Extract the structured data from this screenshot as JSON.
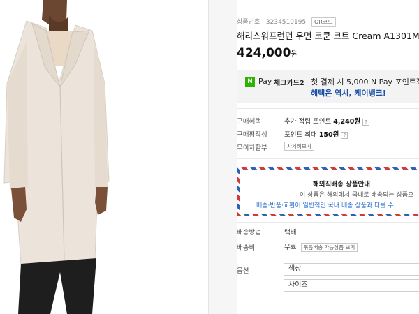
{
  "product": {
    "number_label": "상품번호 :",
    "number": "3234510195",
    "qr_label": "QR코드",
    "title": "해리스워프런던 우먼 코쿤 코트 Cream A1301MLK",
    "price": "424,000",
    "price_unit": "원"
  },
  "promo": {
    "npay_icon": "N",
    "npay_label": "Pay",
    "card_label": "체크카드2",
    "line1": "첫 결제 시 5,000 N Pay 포인트적립",
    "line2": "혜택은 역시, 케이뱅크!"
  },
  "benefits": {
    "purchase_benefit_label": "구매혜택",
    "purchase_benefit_text": "추가 적립 포인트",
    "purchase_benefit_value": "4,240원",
    "review_label": "구매평작성",
    "review_text": "포인트 최대",
    "review_value": "150원",
    "installment_label": "무이자할부",
    "installment_btn": "자세히보기",
    "help_glyph": "?"
  },
  "overseas": {
    "title": "해외직배송 상품안내",
    "line1": "이 상품은 해외에서 국내로 배송되는 상품으",
    "line2": "배송·반품·교환이 일반적인 국내 배송 상품과 다를 수"
  },
  "shipping": {
    "method_label": "배송방법",
    "method_value": "택배",
    "fee_label": "배송비",
    "fee_value": "무료",
    "bundle_btn": "묶음배송 가능상품 보기"
  },
  "options": {
    "label": "옵션",
    "color_placeholder": "색상",
    "size_placeholder": "사이즈"
  }
}
